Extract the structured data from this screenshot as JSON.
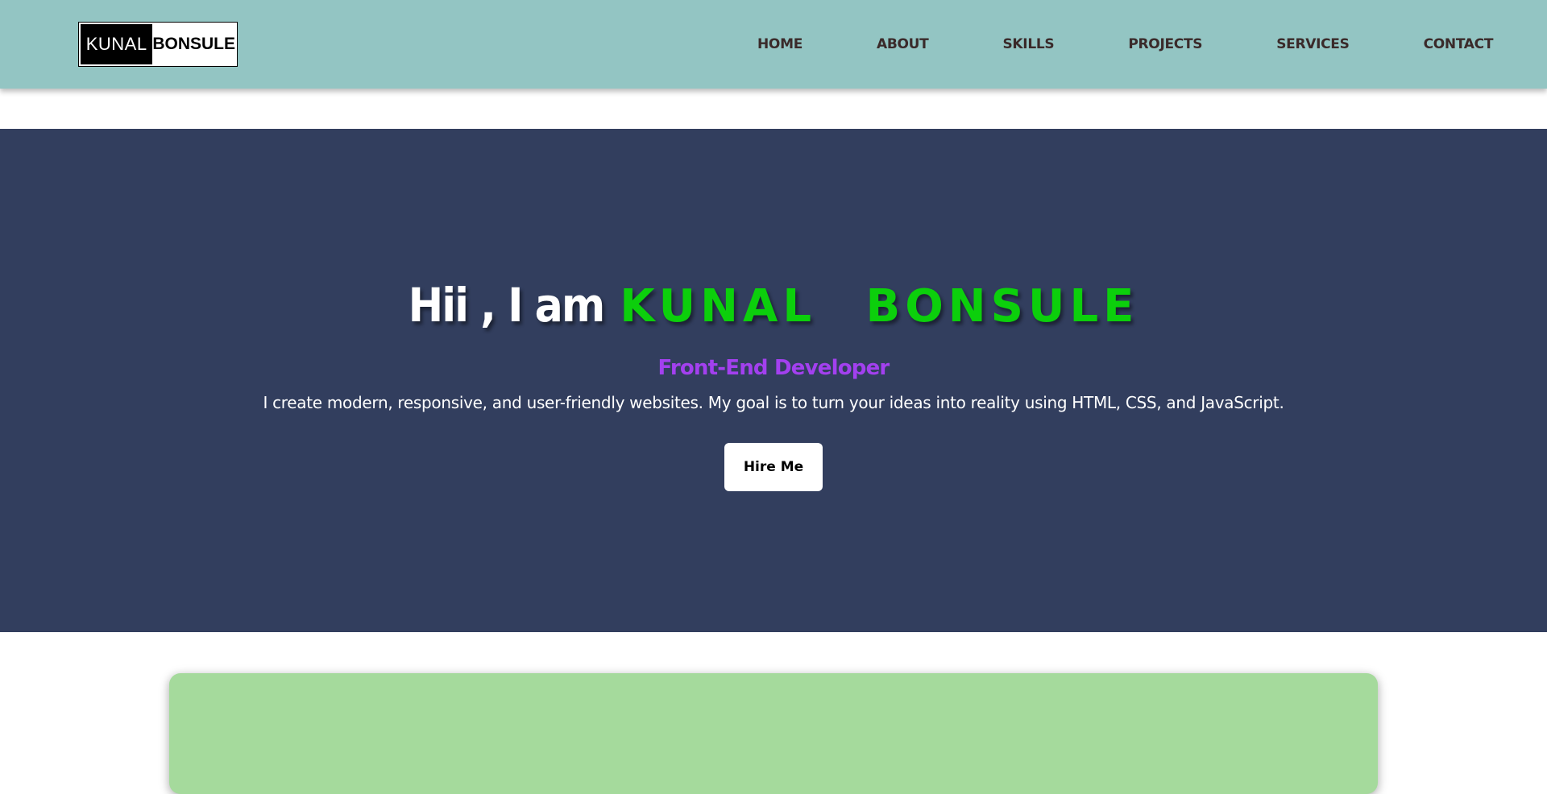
{
  "logo": {
    "first": "KUNAL",
    "last": "BONSULE"
  },
  "nav": {
    "items": [
      {
        "label": "HOME"
      },
      {
        "label": "ABOUT"
      },
      {
        "label": "SKILLS"
      },
      {
        "label": "PROJECTS"
      },
      {
        "label": "SERVICES"
      },
      {
        "label": "CONTACT"
      }
    ]
  },
  "hero": {
    "greeting": "Hii , I am",
    "name": "KUNAL   BONSULE",
    "role": "Front-End Developer",
    "description": "I create modern, responsive, and user-friendly websites. My goal is to turn your ideas into reality using HTML, CSS, and JavaScript.",
    "cta_label": "Hire Me"
  },
  "colors": {
    "navbar": "#93c5c3",
    "hero_bg": "#323e5e",
    "name_accent": "#0ccf0c",
    "role_accent": "#a340ef",
    "card_bg": "#a5da9c"
  }
}
